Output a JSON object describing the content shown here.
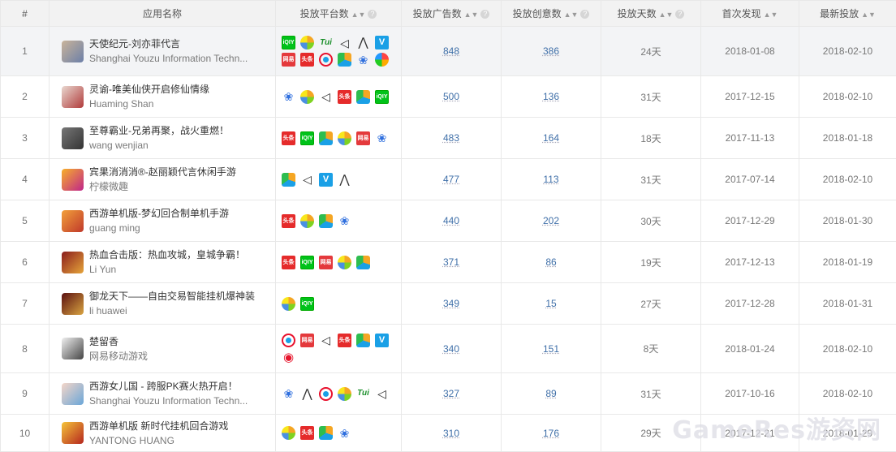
{
  "table": {
    "headers": {
      "idx": "#",
      "app": "应用名称",
      "platforms": "投放平台数",
      "ads": "投放广告数",
      "creatives": "投放创意数",
      "days": "投放天数",
      "first": "首次发现",
      "last": "最新投放"
    },
    "rows": [
      {
        "idx": "1",
        "name": "天使纪元-刘亦菲代言",
        "dev": "Shanghai Youzu Information Techn...",
        "icon": "app-icon-angel",
        "color1": "#c9b49a",
        "color2": "#6c7fa8",
        "platforms": [
          "iqiyi-icon",
          "fan-icon",
          "tui-icon",
          "unity-icon",
          "arrow-icon",
          "vivo-icon",
          "wangyi-icon",
          "toutiao-icon",
          "tencent-video-icon",
          "huluwa-icon",
          "baidu-icon",
          "circle-icon"
        ],
        "ads": "848",
        "creatives": "386",
        "days": "24天",
        "first": "2018-01-08",
        "last": "2018-02-10"
      },
      {
        "idx": "2",
        "name": "灵谕-唯美仙侠开启修仙情缘",
        "dev": "Huaming Shan",
        "icon": "app-icon-lingyu",
        "color1": "#e9d8d0",
        "color2": "#b03a3a",
        "platforms": [
          "baidu-icon",
          "fan-icon",
          "unity-icon",
          "toutiao-icon",
          "huluwa-icon",
          "iqiyi-icon"
        ],
        "ads": "500",
        "creatives": "136",
        "days": "31天",
        "first": "2017-12-15",
        "last": "2018-02-10"
      },
      {
        "idx": "3",
        "name": "至尊霸业-兄弟再聚，战火重燃！",
        "dev": "wang wenjian",
        "icon": "app-icon-long",
        "color1": "#777",
        "color2": "#333",
        "platforms": [
          "toutiao-icon",
          "iqiyi-icon",
          "huluwa-icon",
          "fan-icon",
          "wangyi-icon",
          "baidu-icon"
        ],
        "ads": "483",
        "creatives": "164",
        "days": "18天",
        "first": "2017-11-13",
        "last": "2018-01-18"
      },
      {
        "idx": "4",
        "name": "宾果消消消®-赵丽颖代言休闲手游",
        "dev": "柠檬微趣",
        "icon": "app-icon-bingo",
        "color1": "#f7b02a",
        "color2": "#c0258a",
        "platforms": [
          "huluwa-icon",
          "unity-icon",
          "vivo-icon",
          "arrow-icon"
        ],
        "ads": "477",
        "creatives": "113",
        "days": "31天",
        "first": "2017-07-14",
        "last": "2018-02-10"
      },
      {
        "idx": "5",
        "name": "西游单机版-梦幻回合制单机手游",
        "dev": "guang ming",
        "icon": "app-icon-xiyou",
        "color1": "#f2a03a",
        "color2": "#c0392b",
        "platforms": [
          "toutiao-icon",
          "fan-icon",
          "huluwa-icon",
          "baidu-icon"
        ],
        "ads": "440",
        "creatives": "202",
        "days": "30天",
        "first": "2017-12-29",
        "last": "2018-01-30"
      },
      {
        "idx": "6",
        "name": "热血合击版：热血攻城，皇城争霸！",
        "dev": "Li Yun",
        "icon": "app-icon-rexue",
        "color1": "#8a1c1c",
        "color2": "#e6a53a",
        "platforms": [
          "toutiao-icon",
          "iqiyi-icon",
          "wangyi-icon",
          "fan-icon",
          "huluwa-icon"
        ],
        "ads": "371",
        "creatives": "86",
        "days": "19天",
        "first": "2017-12-13",
        "last": "2018-01-19"
      },
      {
        "idx": "7",
        "name": "御龙天下——自由交易智能挂机爆神装",
        "dev": "li huawei",
        "icon": "app-icon-yulong",
        "color1": "#5a1010",
        "color2": "#d9a441",
        "platforms": [
          "fan-icon",
          "iqiyi-icon"
        ],
        "ads": "349",
        "creatives": "15",
        "days": "27天",
        "first": "2017-12-28",
        "last": "2018-01-31"
      },
      {
        "idx": "8",
        "name": "楚留香",
        "dev": "网易移动游戏",
        "icon": "app-icon-chuliuxiang",
        "color1": "#f0f0f0",
        "color2": "#444",
        "platforms": [
          "tencent-video-icon",
          "wangyi-icon",
          "unity-icon",
          "toutiao-icon",
          "huluwa-icon",
          "vivo-icon",
          "weibo-icon"
        ],
        "ads": "340",
        "creatives": "151",
        "days": "8天",
        "first": "2018-01-24",
        "last": "2018-02-10"
      },
      {
        "idx": "9",
        "name": "西游女儿国 - 跨服PK赛火热开启！",
        "dev": "Shanghai Youzu Information Techn...",
        "icon": "app-icon-nverguo",
        "color1": "#f5d6c8",
        "color2": "#6aa6d8",
        "platforms": [
          "baidu-icon",
          "arrow-icon",
          "tencent-video-icon",
          "fan-icon",
          "tui-icon",
          "unity-icon"
        ],
        "ads": "327",
        "creatives": "89",
        "days": "31天",
        "first": "2017-10-16",
        "last": "2018-02-10"
      },
      {
        "idx": "10",
        "name": "西游单机版 新时代挂机回合游戏",
        "dev": "YANTONG HUANG",
        "icon": "app-icon-xiyou2",
        "color1": "#f5c43a",
        "color2": "#b5261e",
        "platforms": [
          "fan-icon",
          "toutiao-icon",
          "huluwa-icon",
          "baidu-icon"
        ],
        "ads": "310",
        "creatives": "176",
        "days": "29天",
        "first": "2017-12-21",
        "last": "2018-01-29"
      }
    ]
  },
  "platform_glyphs": {
    "iqiyi-icon": "iQIY",
    "tui-icon": "Tui",
    "unity-icon": "◁",
    "arrow-icon": "⋀",
    "vivo-icon": "V",
    "wangyi-icon": "网易",
    "toutiao-icon": "头条",
    "baidu-icon": "❀",
    "weibo-icon": "◉"
  },
  "watermark": "GameRes游资网"
}
